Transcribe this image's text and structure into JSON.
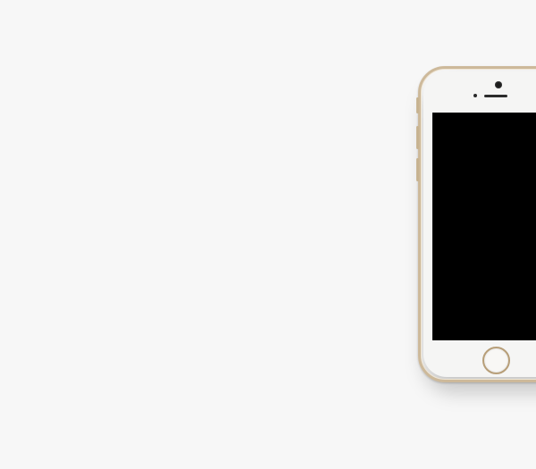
{
  "scene": {
    "background_color": "#f7f7f7",
    "subject": "smartphone",
    "phone_colors": {
      "body": "#f5f5f4",
      "trim": "#cdb99a",
      "screen": "#000000"
    }
  }
}
